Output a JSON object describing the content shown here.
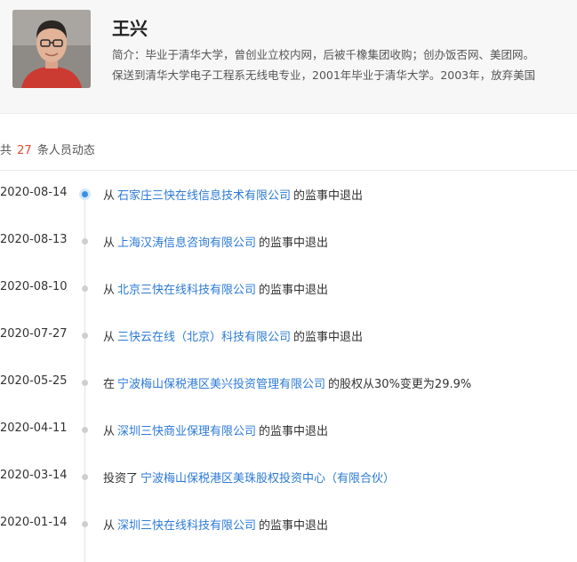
{
  "profile": {
    "name": "王兴",
    "bio_line1": "简介：毕业于清华大学，曾创业立校内网，后被千橡集团收购；创办饭否网、美团网。",
    "bio_line2": "保送到清华大学电子工程系无线电专业，2001年毕业于清华大学。2003年，放弃美国"
  },
  "summary": {
    "prefix": "共",
    "count": "27",
    "suffix": "条人员动态"
  },
  "events": [
    {
      "date": "2020-08-14",
      "pre": "从",
      "company": "石家庄三快在线信息技术有限公司",
      "post": "的监事中退出"
    },
    {
      "date": "2020-08-13",
      "pre": "从",
      "company": "上海汉涛信息咨询有限公司",
      "post": "的监事中退出"
    },
    {
      "date": "2020-08-10",
      "pre": "从",
      "company": "北京三快在线科技有限公司",
      "post": "的监事中退出"
    },
    {
      "date": "2020-07-27",
      "pre": "从",
      "company": "三快云在线（北京）科技有限公司",
      "post": "的监事中退出"
    },
    {
      "date": "2020-05-25",
      "pre": "在",
      "company": "宁波梅山保税港区美兴投资管理有限公司",
      "post": "的股权从30%变更为29.9%"
    },
    {
      "date": "2020-04-11",
      "pre": "从",
      "company": "深圳三快商业保理有限公司",
      "post": "的监事中退出"
    },
    {
      "date": "2020-03-14",
      "pre": "投资了",
      "company": "宁波梅山保税港区美珠股权投资中心（有限合伙）",
      "post": ""
    },
    {
      "date": "2020-01-14",
      "pre": "从",
      "company": "深圳三快在线科技有限公司",
      "post": "的监事中退出"
    }
  ],
  "colors": {
    "link": "#2d7ad6",
    "count": "#e8492f",
    "active_dot": "#3a8fe0"
  }
}
